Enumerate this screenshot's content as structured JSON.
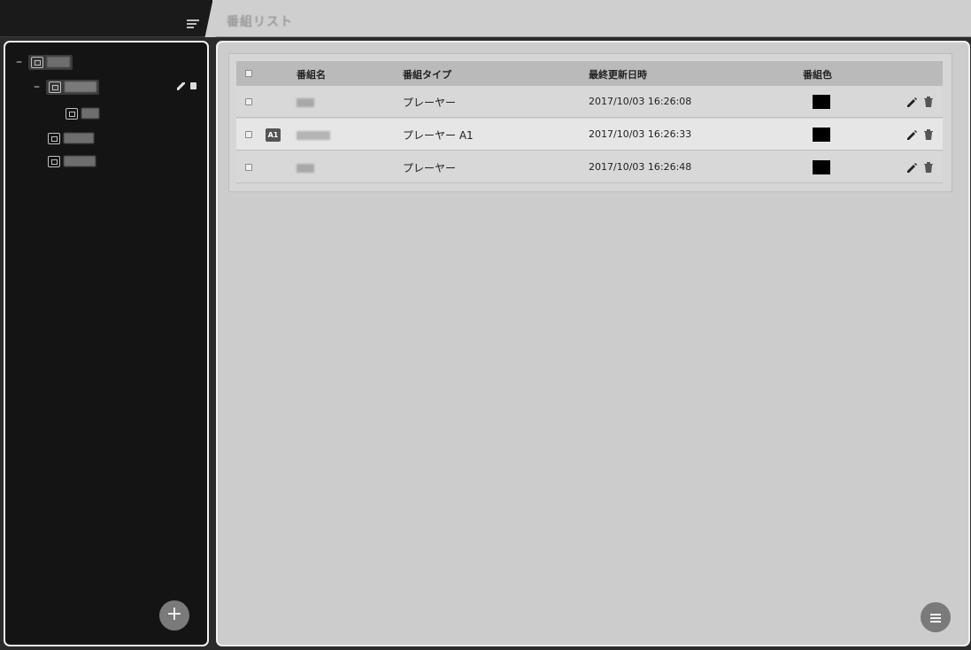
{
  "header": {
    "title": "番組リスト"
  },
  "table": {
    "columns": [
      "番組名",
      "番組タイプ",
      "最終更新日時",
      "番組色"
    ],
    "rows": [
      {
        "badge": "",
        "type": "プレーヤー",
        "updated": "2017/10/03 16:26:08",
        "color": "#000000"
      },
      {
        "badge": "A1",
        "type": "プレーヤー A1",
        "updated": "2017/10/03 16:26:33",
        "color": "#000000"
      },
      {
        "badge": "",
        "type": "プレーヤー",
        "updated": "2017/10/03 16:26:48",
        "color": "#000000"
      }
    ]
  },
  "sidebar": {
    "add_label": "+"
  },
  "icons": [
    "menu-icon",
    "folder-icon",
    "pencil-icon",
    "trash-icon",
    "add-icon",
    "hamburger-icon"
  ]
}
